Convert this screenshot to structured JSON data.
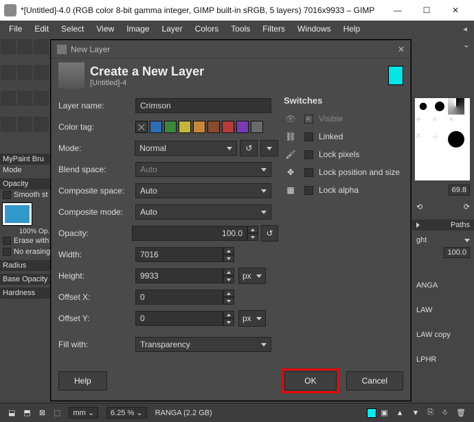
{
  "window": {
    "title": "*[Untitled]-4.0 (RGB color 8-bit gamma integer, GIMP built-in sRGB, 5 layers) 7016x9933 – GIMP"
  },
  "menu": [
    "File",
    "Edit",
    "Select",
    "View",
    "Image",
    "Layer",
    "Colors",
    "Tools",
    "Filters",
    "Windows",
    "Help"
  ],
  "dialog": {
    "title": "New Layer",
    "heading": "Create a New Layer",
    "subheading": "[Untitled]-4",
    "labels": {
      "layer_name": "Layer name:",
      "color_tag": "Color tag:",
      "mode": "Mode:",
      "blend_space": "Blend space:",
      "composite_space": "Composite space:",
      "composite_mode": "Composite mode:",
      "opacity": "Opacity:",
      "width": "Width:",
      "height": "Height:",
      "offset_x": "Offset X:",
      "offset_y": "Offset Y:",
      "fill_with": "Fill with:"
    },
    "values": {
      "layer_name": "Crimson",
      "mode": "Normal",
      "blend_space": "Auto",
      "composite_space": "Auto",
      "composite_mode": "Auto",
      "opacity": "100.0",
      "width": "7016",
      "height": "9933",
      "offset_x": "0",
      "offset_y": "0",
      "unit": "px",
      "fill_with": "Transparency"
    },
    "color_tags": [
      "#3a3a3a",
      "#2d6fb5",
      "#3a8a3a",
      "#c7b53a",
      "#c7853a",
      "#8a4a2d",
      "#b53a3a",
      "#7a3ab5",
      "#6a6a6a"
    ],
    "switches": {
      "heading": "Switches",
      "items": [
        {
          "key": "visible",
          "label": "Visible",
          "checked": true,
          "disabled": true
        },
        {
          "key": "linked",
          "label": "Linked",
          "checked": false,
          "disabled": false
        },
        {
          "key": "lock_pixels",
          "label": "Lock pixels",
          "checked": false,
          "disabled": false
        },
        {
          "key": "lock_pos",
          "label": "Lock position and size",
          "checked": false,
          "disabled": false
        },
        {
          "key": "lock_alpha",
          "label": "Lock alpha",
          "checked": false,
          "disabled": false
        }
      ]
    },
    "buttons": {
      "help": "Help",
      "ok": "OK",
      "cancel": "Cancel"
    }
  },
  "left": {
    "mypaint": "MyPaint Bru",
    "mode": "Mode",
    "opacity_hdr": "Opacity",
    "smooth": "Smooth st",
    "fill_caption": "100% Op.",
    "erase": "Erase with",
    "noerase": "No erasing",
    "radius": "Radius",
    "baseop": "Base Opacity",
    "hardness": "Hardness"
  },
  "right": {
    "zoom": "69.8",
    "paths": "Paths",
    "light": "ght",
    "val": "100.0",
    "items": [
      "ANGA",
      "LAW",
      "LAW copy",
      "LPHR"
    ]
  },
  "status": {
    "unit": "mm",
    "zoom": "6.25 %",
    "layer": "RANGA (2.2 GB)"
  }
}
